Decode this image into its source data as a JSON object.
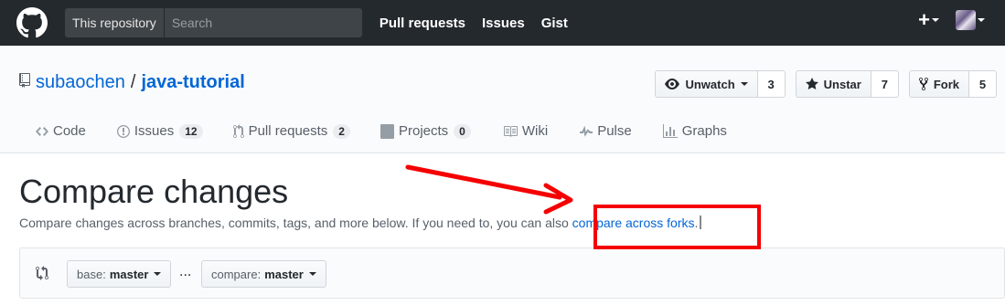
{
  "header": {
    "scope_label": "This repository",
    "search_placeholder": "Search",
    "nav": [
      "Pull requests",
      "Issues",
      "Gist"
    ],
    "plus_label": "+"
  },
  "repo": {
    "owner": "subaochen",
    "separator": "/",
    "name": "java-tutorial",
    "watch": {
      "label": "Unwatch",
      "count": "3"
    },
    "star": {
      "label": "Unstar",
      "count": "7"
    },
    "fork": {
      "label": "Fork",
      "count": "5"
    }
  },
  "tabs": [
    {
      "label": "Code",
      "icon": "code-icon"
    },
    {
      "label": "Issues",
      "icon": "issue-icon",
      "counter": "12"
    },
    {
      "label": "Pull requests",
      "icon": "pull-request-icon",
      "counter": "2"
    },
    {
      "label": "Projects",
      "icon": "project-icon",
      "counter": "0"
    },
    {
      "label": "Wiki",
      "icon": "book-icon"
    },
    {
      "label": "Pulse",
      "icon": "pulse-icon"
    },
    {
      "label": "Graphs",
      "icon": "graph-icon"
    }
  ],
  "compare": {
    "title": "Compare changes",
    "description": "Compare changes across branches, commits, tags, and more below. If you need to, you can also ",
    "link": "compare across forks",
    "link_suffix": ".",
    "base_prefix": "base:",
    "base_value": "master",
    "compare_prefix": "compare:",
    "compare_value": "master",
    "dots": "..."
  },
  "colors": {
    "header_bg": "#24292e",
    "link": "#0366d6",
    "annotation": "#f50000"
  }
}
